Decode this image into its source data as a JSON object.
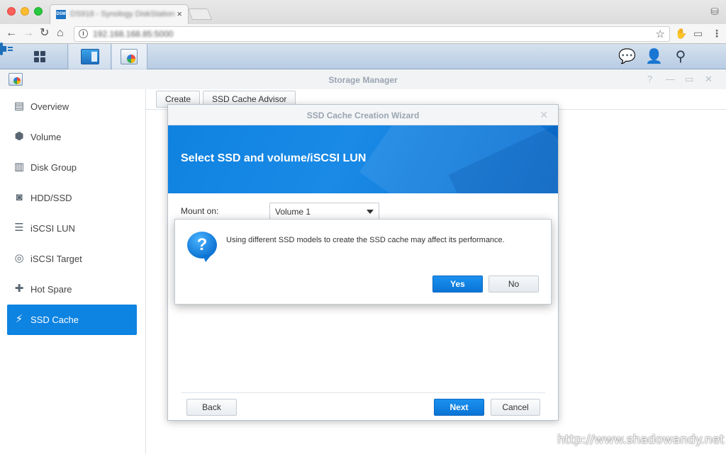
{
  "browser": {
    "tab_favicon_text": "DSM",
    "tab_title": "DS918 - Synology DiskStation",
    "tab_close": "×",
    "url": "192.168.168.85:5000",
    "icons": [
      "back-arrow-icon",
      "forward-arrow-icon",
      "reload-icon",
      "home-icon",
      "info-icon",
      "star-icon",
      "extension-icon",
      "cast-icon",
      "menu-icon"
    ]
  },
  "taskbar": {
    "icons": [
      "main-menu-icon",
      "storage-manager-icon",
      "ssd-wizard-icon",
      "chat-icon",
      "user-icon",
      "search-icon",
      "widgets-icon"
    ]
  },
  "window": {
    "title": "Storage Manager",
    "controls": [
      "?",
      "—",
      "▭",
      "✕"
    ]
  },
  "sidebar": {
    "items": [
      {
        "label": "Overview",
        "icon": "overview-icon",
        "glyph": "▤",
        "active": false
      },
      {
        "label": "Volume",
        "icon": "volume-icon",
        "glyph": "⬢",
        "active": false
      },
      {
        "label": "Disk Group",
        "icon": "disk-group-icon",
        "glyph": "▥",
        "active": false
      },
      {
        "label": "HDD/SSD",
        "icon": "hdd-icon",
        "glyph": "◙",
        "active": false
      },
      {
        "label": "iSCSI LUN",
        "icon": "iscsi-lun-icon",
        "glyph": "☰",
        "active": false
      },
      {
        "label": "iSCSI Target",
        "icon": "iscsi-target-icon",
        "glyph": "◎",
        "active": false
      },
      {
        "label": "Hot Spare",
        "icon": "hot-spare-icon",
        "glyph": "✚",
        "active": false
      },
      {
        "label": "SSD Cache",
        "icon": "ssd-cache-icon",
        "glyph": "⚡",
        "active": true
      }
    ]
  },
  "toolbar": {
    "create_label": "Create",
    "advisor_label": "SSD Cache Advisor"
  },
  "wizard": {
    "title": "SSD Cache Creation Wizard",
    "close": "✕",
    "banner_title": "Select SSD and volume/iSCSI LUN",
    "mount_label": "Mount on:",
    "mount_value": "Volume 1",
    "back_label": "Back",
    "next_label": "Next",
    "cancel_label": "Cancel"
  },
  "confirm": {
    "icon_glyph": "?",
    "message": "Using different SSD models to create the SSD cache may affect its performance.",
    "yes_label": "Yes",
    "no_label": "No"
  },
  "watermark": "http://www.shadowandy.net",
  "colors": {
    "accent": "#0d83e2",
    "banner": "#1a8ae6"
  }
}
